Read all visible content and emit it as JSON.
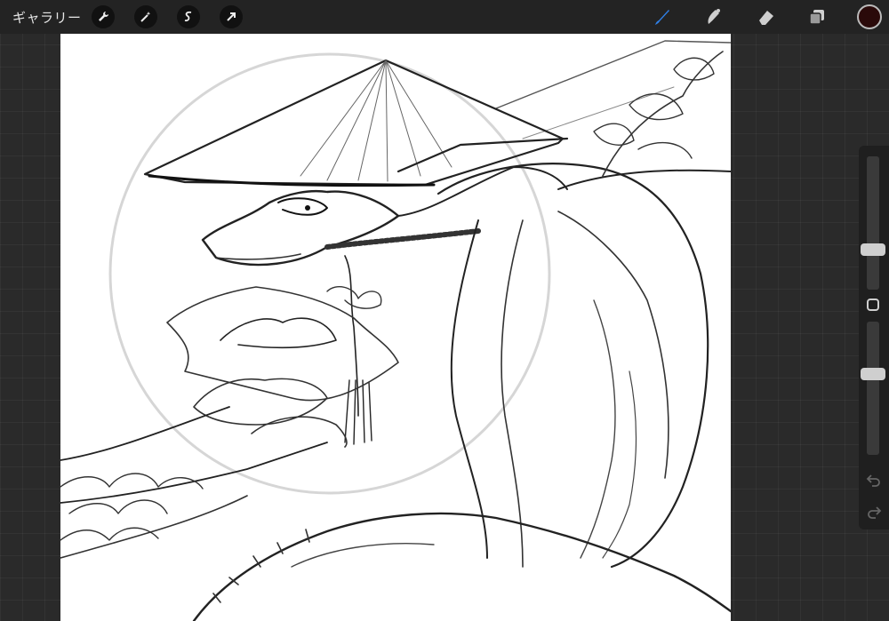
{
  "topbar": {
    "gallery_label": "ギャラリー",
    "left_tools": [
      "wrench-icon",
      "magic-wand-icon",
      "selection-icon",
      "transform-arrow-icon"
    ],
    "right_tools": [
      "brush-icon",
      "smudge-icon",
      "eraser-icon",
      "layers-icon"
    ],
    "active_tool": "brush-icon",
    "active_color": "#2a0a0a",
    "accent_color": "#2f7fe6"
  },
  "sidebar": {
    "brush_size": 0.28,
    "brush_opacity": 0.62,
    "items": [
      "brush-size-slider",
      "modify-square",
      "brush-opacity-slider",
      "undo-icon",
      "redo-icon"
    ]
  }
}
